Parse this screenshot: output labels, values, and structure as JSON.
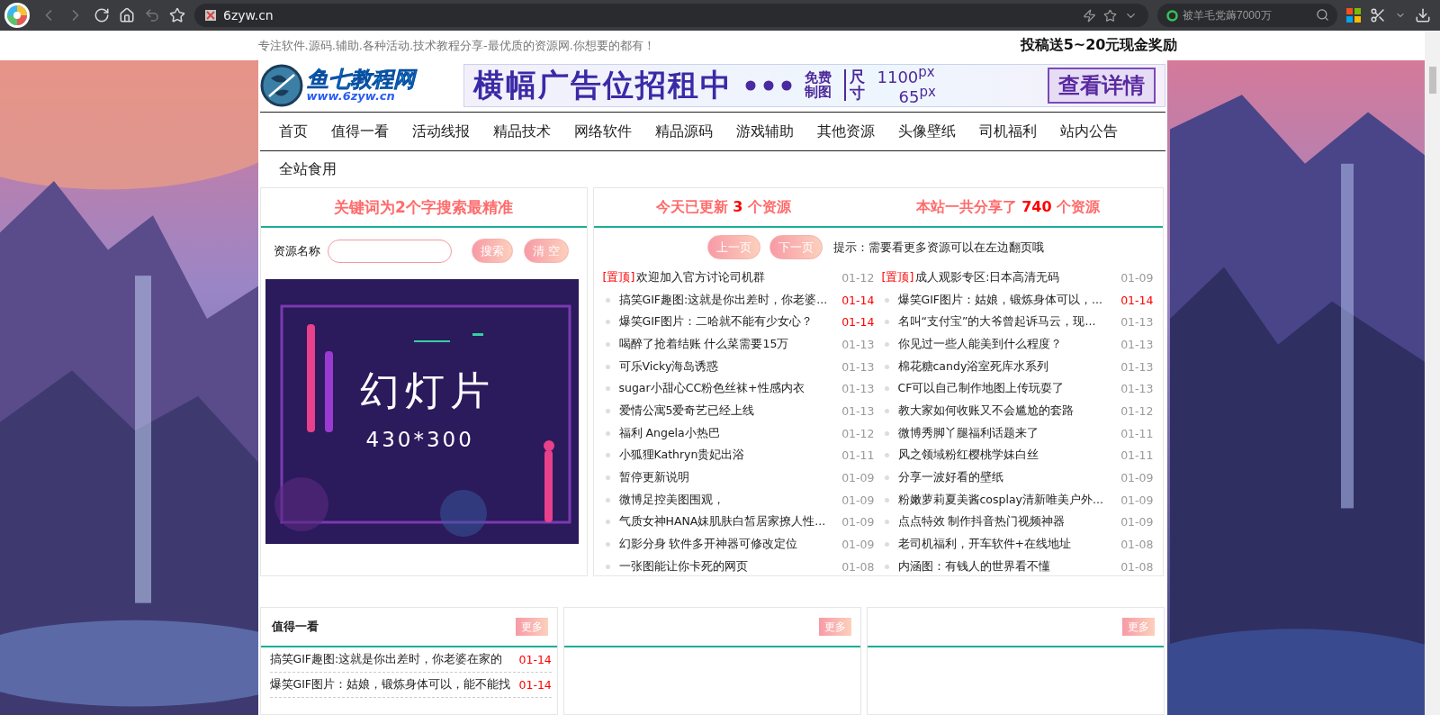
{
  "browser": {
    "url": "6zyw.cn",
    "search_placeholder": "被羊毛党薅7000万"
  },
  "topbar": {
    "tagline": "专注软件.源码.辅助.各种活动.技术教程分享-最优质的资源网.你想要的都有！",
    "promo": "投稿送5~20元现金奖励"
  },
  "header": {
    "logo_title": "鱼七教程网",
    "logo_url": "www.6zyw.cn",
    "ad": {
      "headline": "横幅广告位招租中",
      "free_top": "免费",
      "free_bottom": "制图",
      "size_label": "尺寸",
      "width": "1100$^{px}$",
      "height": "65$^{px}$",
      "cta": "查看详情"
    }
  },
  "nav": [
    "首页",
    "值得一看",
    "活动线报",
    "精品技术",
    "网络软件",
    "精品源码",
    "游戏辅助",
    "其他资源",
    "头像壁纸",
    "司机福利",
    "站内公告",
    "全站食用"
  ],
  "search_panel": {
    "title": "关键词为2个字搜索最精准",
    "label": "资源名称",
    "search_button": "搜索",
    "clear_button": "清 空",
    "slide": {
      "title": "幻灯片",
      "size": "430*300"
    }
  },
  "updates": {
    "today": "今天已更新 **3** 个资源",
    "total": "本站一共分享了 **740** 个资源",
    "prev": "上一页",
    "next": "下一页",
    "hint": "提示：需要看更多资源可以在左边翻页哦",
    "columns": [
      {
        "items": [
          {
            "kind": "pinned",
            "tag": "[置顶]",
            "title": "欢迎加入官方讨论司机群",
            "date": "01-12",
            "hot": false
          },
          {
            "kind": "normal",
            "title": "搞笑GIF趣图:这就是你出差时，你老婆...",
            "date": "01-14",
            "hot": true
          },
          {
            "kind": "normal",
            "title": "爆笑GIF图片：二哈就不能有少女心？",
            "date": "01-14",
            "hot": true
          },
          {
            "kind": "normal",
            "title": "喝醉了抢着结账 什么菜需要15万",
            "date": "01-13",
            "hot": false
          },
          {
            "kind": "normal",
            "title": "可乐Vicky海岛诱惑",
            "date": "01-13",
            "hot": false
          },
          {
            "kind": "normal",
            "title": "sugar小甜心CC粉色丝袜+性感内衣",
            "date": "01-13",
            "hot": false
          },
          {
            "kind": "normal",
            "title": "爱情公寓5爱奇艺已经上线",
            "date": "01-13",
            "hot": false
          },
          {
            "kind": "normal",
            "title": "福利 Angela小热巴",
            "date": "01-12",
            "hot": false
          },
          {
            "kind": "normal",
            "title": "小狐狸Kathryn贵妃出浴",
            "date": "01-11",
            "hot": false
          },
          {
            "kind": "normal",
            "title": "暂停更新说明",
            "date": "01-09",
            "hot": false
          },
          {
            "kind": "normal",
            "title": "微博足控美图围观，",
            "date": "01-09",
            "hot": false
          },
          {
            "kind": "normal",
            "title": "气质女神HANA妹肌肤白皙居家撩人性...",
            "date": "01-09",
            "hot": false
          },
          {
            "kind": "normal",
            "title": "幻影分身 软件多开神器可修改定位",
            "date": "01-09",
            "hot": false
          },
          {
            "kind": "normal",
            "title": "一张图能让你卡死的网页",
            "date": "01-08",
            "hot": false
          }
        ]
      },
      {
        "items": [
          {
            "kind": "pinned",
            "tag": "[置顶]",
            "title": "成人观影专区:日本高清无码",
            "date": "01-09",
            "hot": false
          },
          {
            "kind": "normal",
            "title": "爆笑GIF图片：姑娘，锻炼身体可以，...",
            "date": "01-14",
            "hot": true
          },
          {
            "kind": "normal",
            "title": "名叫“支付宝”的大爷曾起诉马云，现...",
            "date": "01-13",
            "hot": false
          },
          {
            "kind": "normal",
            "title": "你见过一些人能美到什么程度？",
            "date": "01-13",
            "hot": false
          },
          {
            "kind": "normal",
            "title": "棉花糖candy浴室死库水系列",
            "date": "01-13",
            "hot": false
          },
          {
            "kind": "normal",
            "title": "CF可以自己制作地图上传玩耍了",
            "date": "01-13",
            "hot": false
          },
          {
            "kind": "normal",
            "title": "教大家如何收账又不会尴尬的套路",
            "date": "01-12",
            "hot": false
          },
          {
            "kind": "normal",
            "title": "微博秀脚丫腿福利话题来了",
            "date": "01-11",
            "hot": false
          },
          {
            "kind": "normal",
            "title": "风之领域粉红樱桃学妹白丝",
            "date": "01-11",
            "hot": false
          },
          {
            "kind": "normal",
            "title": "分享一波好看的壁纸",
            "date": "01-09",
            "hot": false
          },
          {
            "kind": "normal",
            "title": "粉嫩萝莉夏美酱cosplay清新唯美户外...",
            "date": "01-09",
            "hot": false
          },
          {
            "kind": "normal",
            "title": "点点特效 制作抖音热门视频神器",
            "date": "01-09",
            "hot": false
          },
          {
            "kind": "normal",
            "title": "老司机福利，开车软件+在线地址",
            "date": "01-08",
            "hot": false
          },
          {
            "kind": "normal",
            "title": "内涵图：有钱人的世界看不懂",
            "date": "01-08",
            "hot": false
          }
        ]
      }
    ]
  },
  "cards": [
    {
      "title": "值得一看",
      "more": "更多",
      "items": [
        {
          "title": "搞笑GIF趣图:这就是你出差时，你老婆在家的",
          "date": "01-14",
          "hot": true
        },
        {
          "title": "爆笑GIF图片：姑娘，锻炼身体可以，能不能找",
          "date": "01-14",
          "hot": true
        }
      ]
    },
    {
      "more": "更多"
    },
    {
      "more": "更多"
    }
  ]
}
